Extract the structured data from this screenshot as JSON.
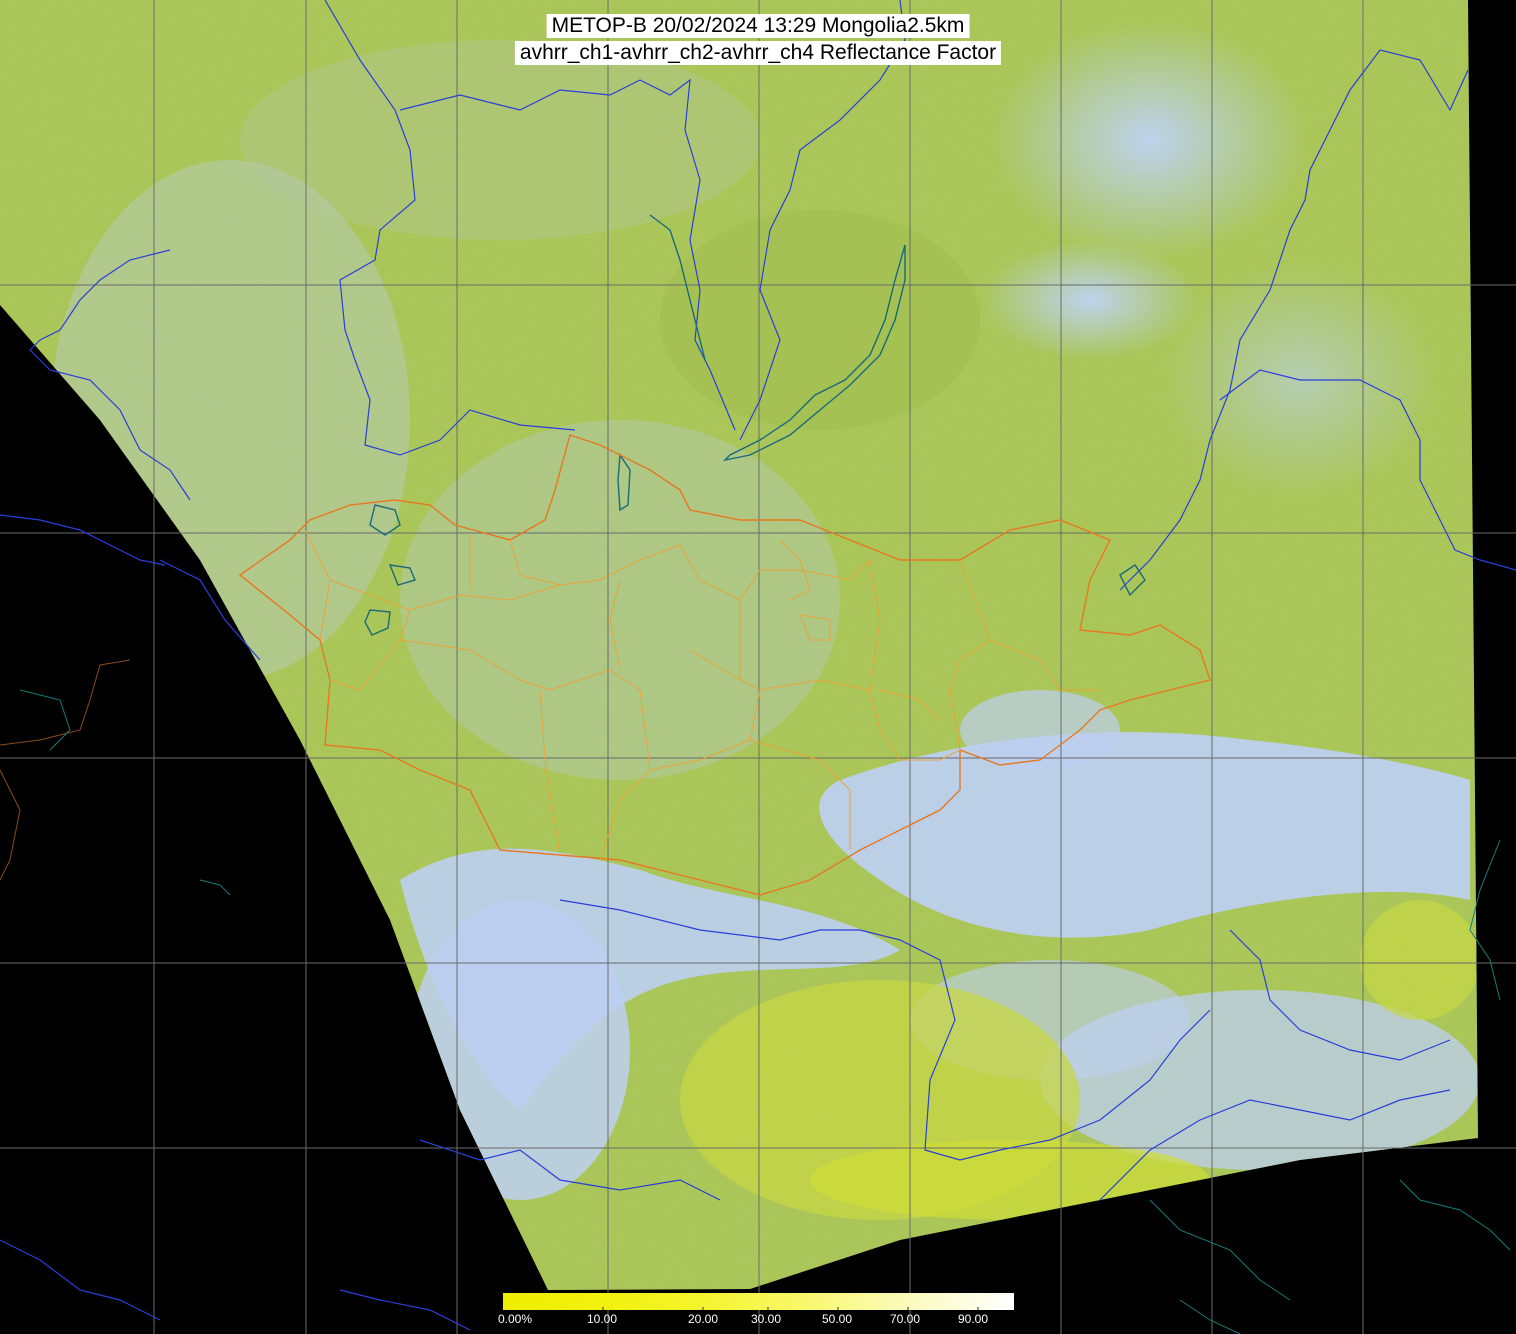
{
  "title": {
    "line1": "METOP-B 20/02/2024 13:29 Mongolia2.5km",
    "line2": "avhrr_ch1-avhrr_ch2-avhrr_ch4 Reflectance Factor"
  },
  "colorbar": {
    "ticks": [
      "0.00%",
      "10.00",
      "20.00",
      "30.00",
      "50.00",
      "70.00",
      "90.00"
    ],
    "colors": [
      "#f0f000",
      "#f5f520",
      "#f8f860",
      "#fafa9a",
      "#fcfcd0",
      "#ffffff"
    ]
  },
  "colors": {
    "background": "#000000",
    "land": "#a9c84a",
    "cloud": "#b8cdf0",
    "grid": "#6a6a6a",
    "rivers": "#2a3fd8",
    "national_border": "#e87820",
    "aimag_border": "#f0a030",
    "lakes": "#1a6a7a"
  }
}
